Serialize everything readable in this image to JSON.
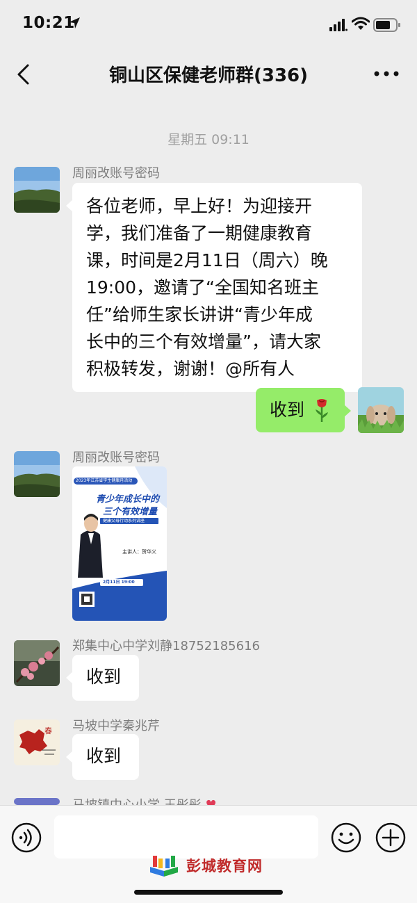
{
  "status_bar": {
    "time": "10:21"
  },
  "header": {
    "title": "铜山区保健老师群(336)"
  },
  "chat": {
    "timestamp": "星期五 09:11",
    "messages": [
      {
        "sender": "周丽改账号密码",
        "lines": [
          "各位老师，早上好！为迎接开",
          "学，我们准备了一期健康教育",
          "课，时间是2月11日（周六）晚",
          "19:00，邀请了“全国知名班主",
          "任”给师生家长讲讲“青少年成",
          "长中的三个有效增量”，请大家",
          "积极转发，谢谢！@所有人"
        ]
      },
      {
        "sender": "",
        "text": "收到",
        "emoji": "rose-icon"
      },
      {
        "sender": "周丽改账号密码",
        "poster": {
          "tag": "2023年江苏省学生健康月活动",
          "title_line1": "青少年成长中的",
          "title_line2": "三个有效增量",
          "subtitle": "健康父母行动系列讲座",
          "speaker": "主讲人：贺华义",
          "time": "2月11日 19:00"
        }
      },
      {
        "sender": "郑集中心中学刘静18752185616",
        "text": "收到"
      },
      {
        "sender": "马坡中学秦兆芹",
        "text": "收到"
      },
      {
        "sender": "马坡镇中心小学 王彤彤"
      }
    ]
  },
  "input_bar": {
    "placeholder": ""
  },
  "watermark": {
    "text": "彭城教育网"
  },
  "colors": {
    "background": "#ededed",
    "self_bubble": "#95ec69",
    "other_bubble": "#ffffff"
  }
}
